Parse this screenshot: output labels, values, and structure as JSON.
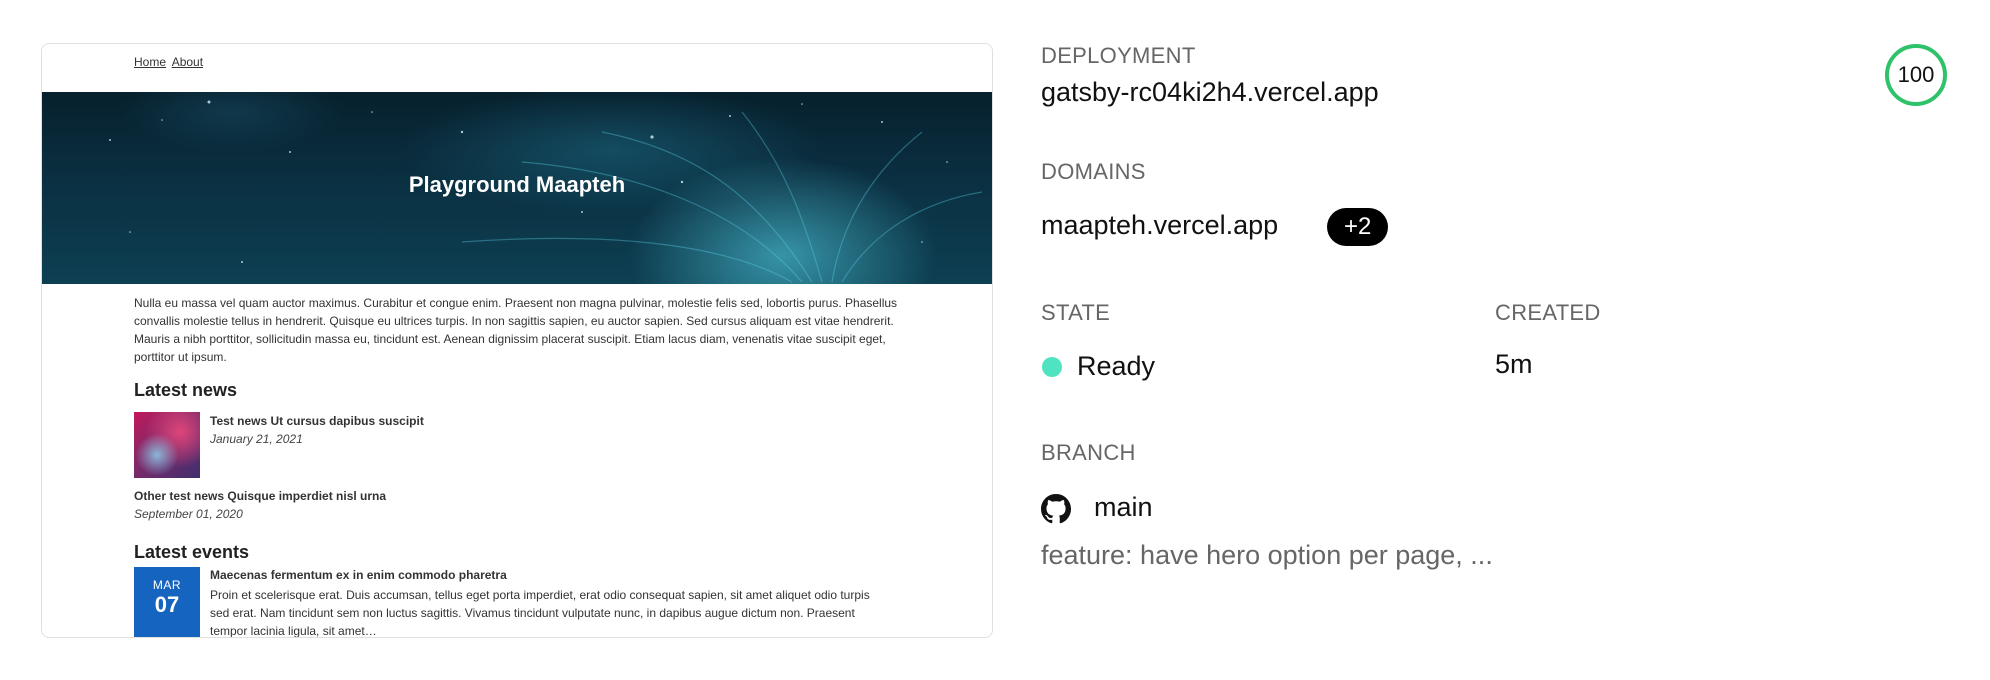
{
  "preview": {
    "nav": [
      "Home",
      "About"
    ],
    "hero_title": "Playground Maapteh",
    "intro": "Nulla eu massa vel quam auctor maximus. Curabitur et congue enim. Praesent non magna pulvinar, molestie felis sed, lobortis purus. Phasellus convallis molestie tellus in hendrerit. Quisque eu ultrices turpis. In non sagittis sapien, eu auctor sapien. Sed cursus aliquam est vitae hendrerit. Mauris a nibh porttitor, sollicitudin massa eu, tincidunt est. Aenean dignissim placerat suscipit. Etiam lacus diam, venenatis vitae suscipit eget, porttitor ut ipsum.",
    "news_heading": "Latest news",
    "news": [
      {
        "title": "Test news Ut cursus dapibus suscipit",
        "date": "January 21, 2021"
      },
      {
        "title": "Other test news Quisque imperdiet nisl urna",
        "date": "September 01, 2020"
      }
    ],
    "events_heading": "Latest events",
    "event": {
      "month": "MAR",
      "day": "07",
      "title": "Maecenas fermentum ex in enim commodo pharetra",
      "text": "Proin et scelerisque erat. Duis accumsan, tellus eget porta imperdiet, erat odio consequat sapien, sit amet aliquet odio turpis sed erat. Nam tincidunt sem non luctus sagittis. Vivamus tincidunt vulputate nunc, in dapibus augue dictum non. Praesent tempor lacinia ligula, sit amet…"
    }
  },
  "details": {
    "deployment_label": "DEPLOYMENT",
    "deployment_url": "gatsby-rc04ki2h4.vercel.app",
    "score": "100",
    "domains_label": "DOMAINS",
    "domain": "maapteh.vercel.app",
    "domains_more": "+2",
    "state_label": "STATE",
    "state": "Ready",
    "created_label": "CREATED",
    "created": "5m",
    "branch_label": "BRANCH",
    "branch": "main",
    "branch_icon": "github-icon",
    "commit_message": "feature: have hero option per page, ..."
  },
  "colors": {
    "ready": "#50e3c2",
    "score_ring": "#2ec26a",
    "event_blue": "#1565c0"
  }
}
